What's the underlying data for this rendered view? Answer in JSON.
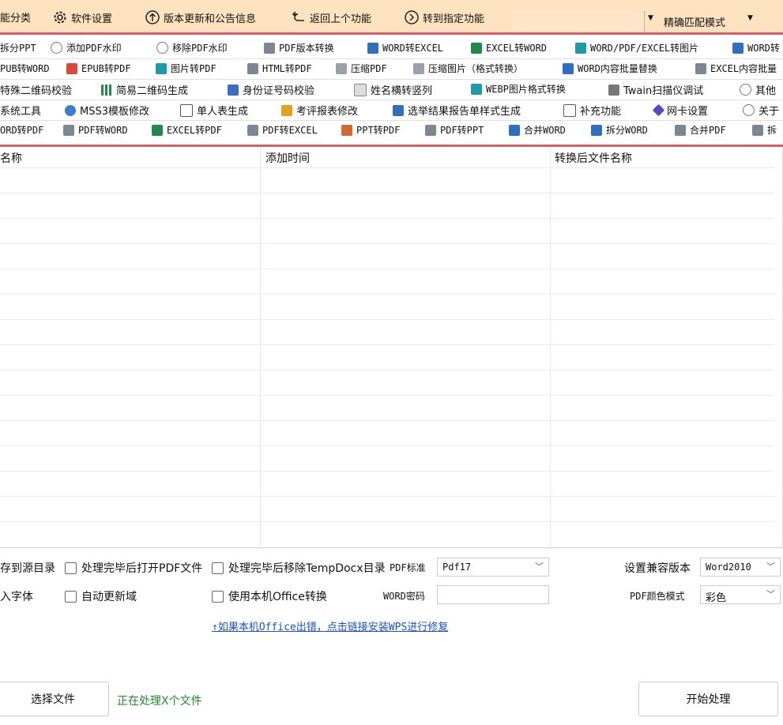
{
  "menu": {
    "category": "能分类",
    "settings": "软件设置",
    "update": "版本更新和公告信息",
    "back": "返回上个功能",
    "goto": "转到指定功能",
    "mode": "精确匹配模式"
  },
  "tools": {
    "row1": [
      "拆分PPT",
      "添加PDF水印",
      "移除PDF水印",
      "PDF版本转换",
      "WORD转EXCEL",
      "EXCEL转WORD",
      "WORD/PDF/EXCEL转图片",
      "WORD转"
    ],
    "row2": [
      "PUB转WORD",
      "EPUB转PDF",
      "图片转PDF",
      "HTML转PDF",
      "压缩PDF",
      "压缩图片（格式转换）",
      "WORD内容批量替换",
      "EXCEL内容批量"
    ],
    "row3": [
      "特殊二维码校验",
      "简易二维码生成",
      "身份证号码校验",
      "姓名横转竖列",
      "WEBP图片格式转换",
      "Twain扫描仪调试",
      "其他"
    ],
    "row4": [
      "系统工具",
      "MSS3模板修改",
      "单人表生成",
      "考评报表修改",
      "选举结果报告单样式生成",
      "补充功能",
      "网卡设置",
      "关于"
    ],
    "row5": [
      "ORD转PDF",
      "PDF转WORD",
      "EXCEL转PDF",
      "PDF转EXCEL",
      "PPT转PDF",
      "PDF转PPT",
      "合并WORD",
      "拆分WORD",
      "合并PDF",
      "拆"
    ]
  },
  "table": {
    "columns": [
      "名称",
      "添加时间",
      "转换后文件名称"
    ]
  },
  "options": {
    "save_to_source": "存到源目录",
    "open_pdf_after": "处理完毕后打开PDF文件",
    "remove_temp": "处理完毕后移除TempDocx目录",
    "pdf_standard_label": "PDF标准",
    "pdf_standard_value": "Pdf17",
    "compat_label": "设置兼容版本",
    "compat_value": "Word2010",
    "embed_font": "入字体",
    "auto_update_field": "自动更新域",
    "use_local_office": "使用本机Office转换",
    "word_password_label": "WORD密码",
    "pdf_color_label": "PDF颜色模式",
    "pdf_color_value": "彩色",
    "fix_link": "↑如果本机Office出错，点击链接安装WPS进行修复"
  },
  "bottom": {
    "choose_file": "选择文件",
    "status": "正在处理X个文件",
    "start": "开始处理"
  }
}
